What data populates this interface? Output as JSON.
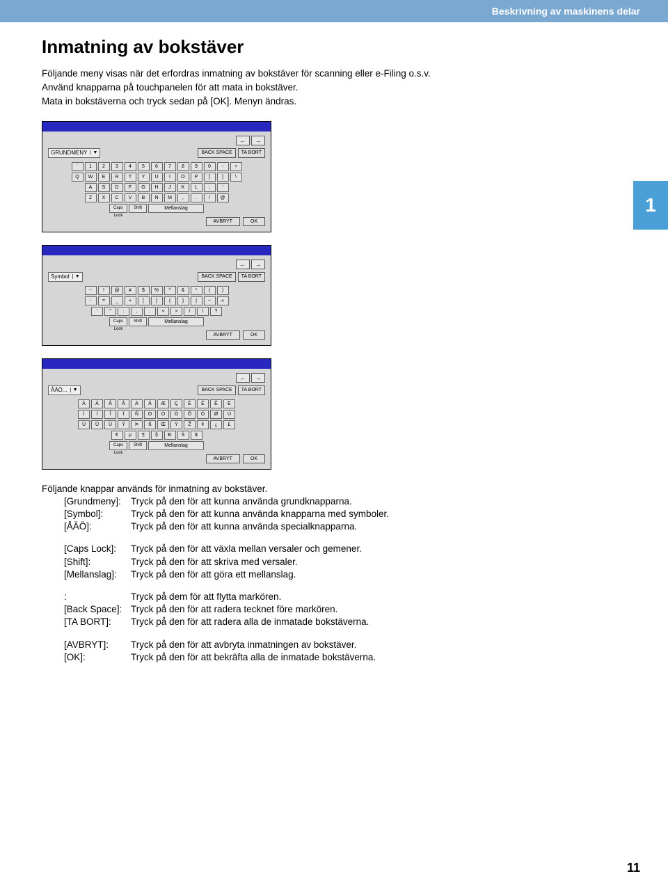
{
  "header": {
    "breadcrumb": "Beskrivning av maskinens delar"
  },
  "chapter_tab": "1",
  "title": "Inmatning av bokstäver",
  "intro": {
    "l1": "Följande meny visas när det erfordras inmatning av bokstäver för scanning eller e-Filing o.s.v.",
    "l2": "Använd knapparna på touchpanelen för att mata in bokstäver.",
    "l3": "Mata in bokstäverna och tryck sedan på [OK]. Menyn ändras."
  },
  "kb": {
    "arrow_left": "←",
    "arrow_right": "→",
    "backspace": "BACK SPACE",
    "delete": "TA BORT",
    "avbryt": "AVBRYT",
    "ok": "OK",
    "capslock": "Caps Lock",
    "shift": "Shift",
    "space": "Mellanslag",
    "panel1": {
      "mode": "GRUNDMENY",
      "row1": [
        "`",
        "1",
        "2",
        "3",
        "4",
        "5",
        "6",
        "7",
        "8",
        "9",
        "0",
        "-",
        "+"
      ],
      "row2": [
        "Q",
        "W",
        "E",
        "R",
        "T",
        "Y",
        "U",
        "I",
        "O",
        "P",
        "[",
        "]",
        "\\"
      ],
      "row3": [
        "A",
        "S",
        "D",
        "F",
        "G",
        "H",
        "J",
        "K",
        "L",
        ";",
        "'"
      ],
      "row4": [
        "Z",
        "X",
        "C",
        "V",
        "B",
        "N",
        "M",
        ",",
        ".",
        "/",
        "@"
      ]
    },
    "panel2": {
      "mode": "Symbol",
      "row1": [
        "~",
        "!",
        "@",
        "#",
        "$",
        "%",
        "^",
        "&",
        "*",
        "(",
        ")"
      ],
      "row2": [
        "-",
        "=",
        "_",
        "+",
        "[",
        "]",
        "{",
        "}",
        "|",
        "~",
        "«"
      ],
      "row3": [
        "'",
        "\"",
        ":",
        ",",
        ".",
        "<",
        ">",
        "/",
        "\\",
        "?"
      ]
    },
    "panel3": {
      "mode": "ÅÄÖ...",
      "row1": [
        "À",
        "Á",
        "Â",
        "Ã",
        "Ä",
        "Å",
        "Æ",
        "Ç",
        "È",
        "É",
        "Ê",
        "Ë"
      ],
      "row2": [
        "Ì",
        "Í",
        "Î",
        "Ï",
        "Ñ",
        "Ò",
        "Ó",
        "Ô",
        "Õ",
        "Ö",
        "Ø",
        "Ù"
      ],
      "row3": [
        "Ú",
        "Û",
        "Ü",
        "Ý",
        "Þ",
        "ß",
        "Œ",
        "Ÿ",
        "Ž",
        "¢",
        "¿",
        "£"
      ],
      "row4": [
        "€",
        "µ",
        "¶",
        "§",
        "Ð",
        "Š",
        "$"
      ]
    }
  },
  "desc": {
    "lead": "Följande knappar används för inmatning av bokstäver.",
    "rows1": [
      {
        "k": "[Grundmeny]:",
        "v": "Tryck på den för att kunna använda grundknapparna."
      },
      {
        "k": "[Symbol]:",
        "v": "Tryck på den för att kunna använda knapparna med symboler."
      },
      {
        "k": "[ÅÄÖ]:",
        "v": "Tryck på den för att kunna använda specialknapparna."
      }
    ],
    "rows2": [
      {
        "k": "[Caps Lock]:",
        "v": "Tryck på den för att växla mellan versaler och gemener."
      },
      {
        "k": "[Shift]:",
        "v": "Tryck på den för att skriva med versaler."
      },
      {
        "k": "[Mellanslag]:",
        "v": "Tryck på den för att göra ett mellanslag."
      }
    ],
    "rows3": [
      {
        "k": ":",
        "v": "Tryck på dem för att flytta markören."
      },
      {
        "k": "[Back Space]:",
        "v": "Tryck på den för att radera tecknet före markören."
      },
      {
        "k": "[TA BORT]:",
        "v": "Tryck på den för att radera alla de inmatade bokstäverna."
      }
    ],
    "rows4": [
      {
        "k": "[AVBRYT]:",
        "v": "Tryck på den för att avbryta inmatningen av bokstäver."
      },
      {
        "k": "[OK]:",
        "v": "Tryck på den för att bekräfta alla de inmatade bokstäverna."
      }
    ]
  },
  "page_number": "11"
}
